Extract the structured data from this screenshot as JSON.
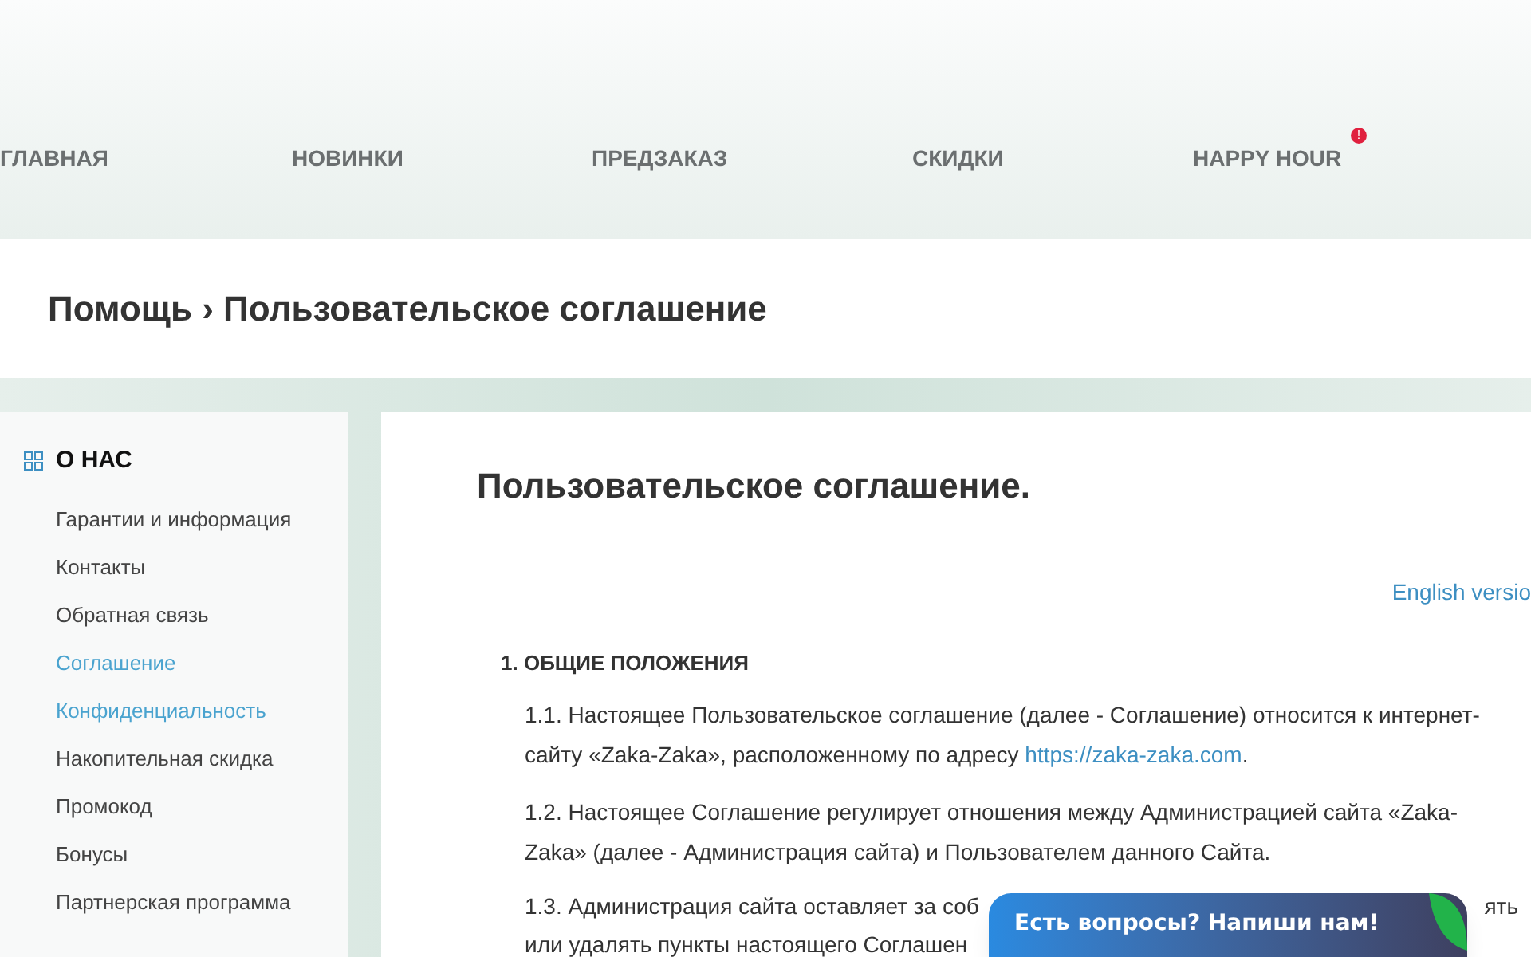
{
  "nav": [
    {
      "label": "ГЛАВНАЯ",
      "badge": false
    },
    {
      "label": "НОВИНКИ",
      "badge": false
    },
    {
      "label": "ПРЕДЗАКАЗ",
      "badge": false
    },
    {
      "label": "СКИДКИ",
      "badge": false
    },
    {
      "label": "HAPPY HOUR",
      "badge": true
    }
  ],
  "nav_badge": "!",
  "breadcrumb": "Помощь › Пользовательское соглашение",
  "sidebar": {
    "heading": "О НАС",
    "items": [
      {
        "label": "Гарантии и информация",
        "highlighted": false
      },
      {
        "label": "Контакты",
        "highlighted": false
      },
      {
        "label": "Обратная связь",
        "highlighted": false
      },
      {
        "label": "Соглашение",
        "highlighted": true
      },
      {
        "label": "Конфиденциальность",
        "highlighted": true
      },
      {
        "label": "Накопительная скидка",
        "highlighted": false
      },
      {
        "label": "Промокод",
        "highlighted": false
      },
      {
        "label": "Бонусы",
        "highlighted": false
      },
      {
        "label": "Партнерская программа",
        "highlighted": false
      }
    ]
  },
  "content": {
    "title": "Пользовательское соглашение.",
    "language_link": "English versio",
    "section": "1. ОБЩИЕ ПОЛОЖЕНИЯ",
    "p1": {
      "before": "1.1. Настоящее Пользовательское соглашение (далее - Соглашение) относится к интернет-сайту «Zaka-Zaka», расположенному по адресу ",
      "link": "https://zaka-zaka.com",
      "after": "."
    },
    "p2": "1.2. Настоящее Соглашение регулирует отношения между Администрацией сайта «Zaka-Zaka» (далее - Администрация сайта) и Пользователем данного Сайта.",
    "p3": {
      "line1_left": "1.3. Администрация сайта оставляет за соб",
      "line1_right": "ять",
      "line2_left": "или удалять пункты настоящего Соглашен"
    }
  },
  "chat": {
    "label": "Есть вопросы? Напиши нам!"
  }
}
